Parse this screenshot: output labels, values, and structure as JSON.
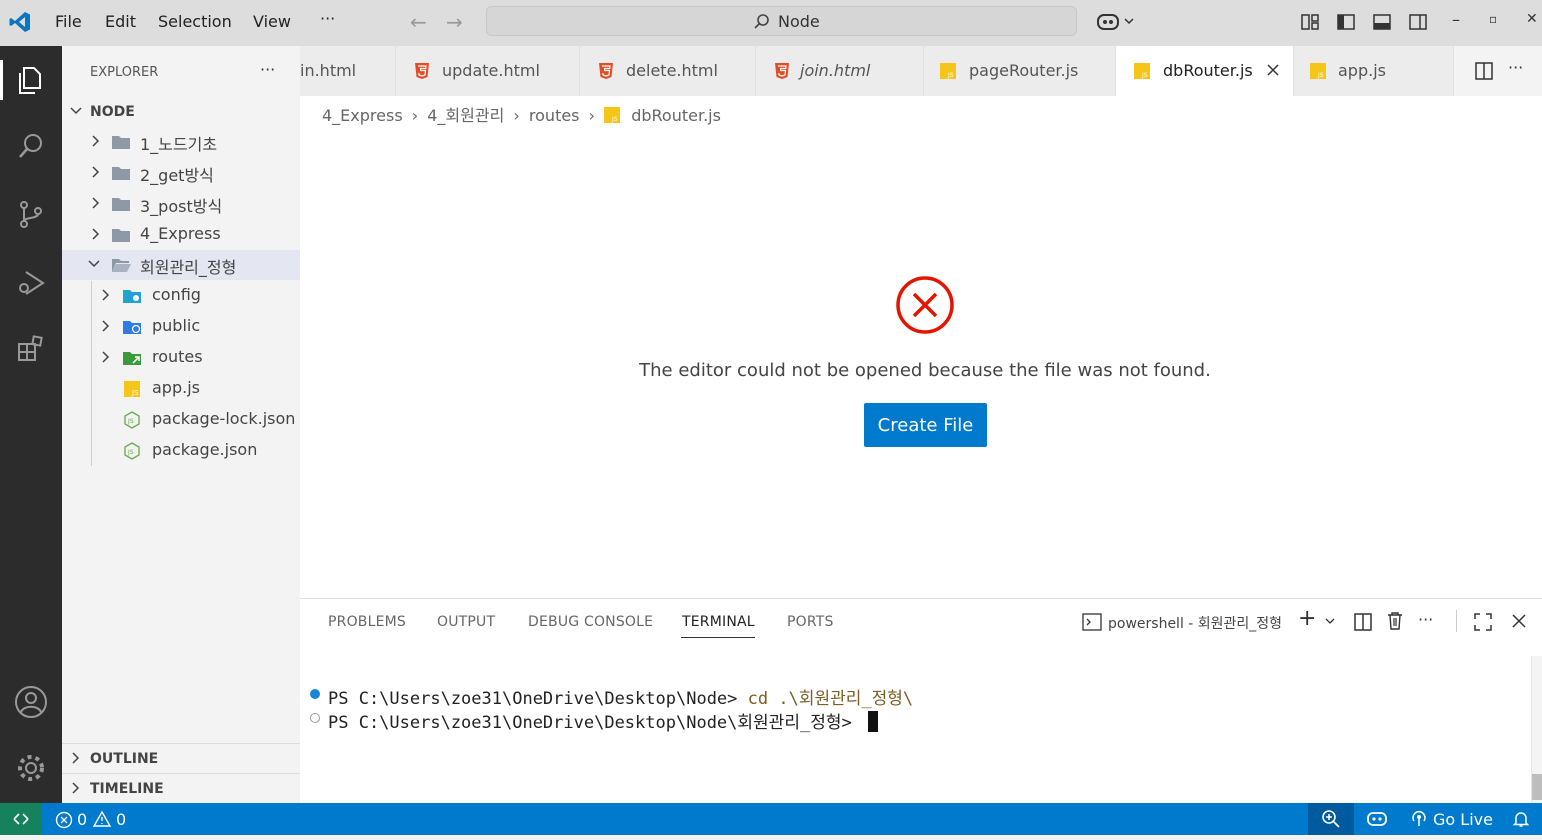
{
  "titlebar": {
    "menu": [
      "File",
      "Edit",
      "Selection",
      "View"
    ],
    "more": "···",
    "search_text": "Node"
  },
  "sidebar": {
    "title": "EXPLORER",
    "more": "···",
    "root": "NODE",
    "items": [
      {
        "label": "1_노드기초"
      },
      {
        "label": "2_get방식"
      },
      {
        "label": "3_post방식"
      },
      {
        "label": "4_Express"
      },
      {
        "label": "회원관리_정형"
      },
      {
        "label": "config"
      },
      {
        "label": "public"
      },
      {
        "label": "routes"
      },
      {
        "label": "app.js"
      },
      {
        "label": "package-lock.json"
      },
      {
        "label": "package.json"
      }
    ],
    "outline": "OUTLINE",
    "timeline": "TIMELINE"
  },
  "tabs": [
    {
      "label": "in.html"
    },
    {
      "label": "update.html"
    },
    {
      "label": "delete.html"
    },
    {
      "label": "join.html"
    },
    {
      "label": "pageRouter.js"
    },
    {
      "label": "dbRouter.js"
    },
    {
      "label": "app.js"
    }
  ],
  "breadcrumb": [
    "4_Express",
    "4_회원관리",
    "routes",
    "dbRouter.js"
  ],
  "editor": {
    "message": "The editor could not be opened because the file was not found.",
    "create_button": "Create File"
  },
  "panel": {
    "tabs": [
      "PROBLEMS",
      "OUTPUT",
      "DEBUG CONSOLE",
      "TERMINAL",
      "PORTS"
    ],
    "shell_label": "powershell - 회원관리_정형",
    "more": "···",
    "lines": [
      {
        "prompt": "PS C:\\Users\\zoe31\\OneDrive\\Desktop\\Node>",
        "command": "cd .\\회원관리_정형\\"
      },
      {
        "prompt": "PS C:\\Users\\zoe31\\OneDrive\\Desktop\\Node\\회원관리_정형>",
        "command": ""
      }
    ]
  },
  "statusbar": {
    "errors": "0",
    "warnings": "0",
    "go_live": "Go Live"
  },
  "colors": {
    "accent": "#007acc",
    "error": "#e51400",
    "html_icon": "#e44d26",
    "js_icon": "#f5c518"
  }
}
